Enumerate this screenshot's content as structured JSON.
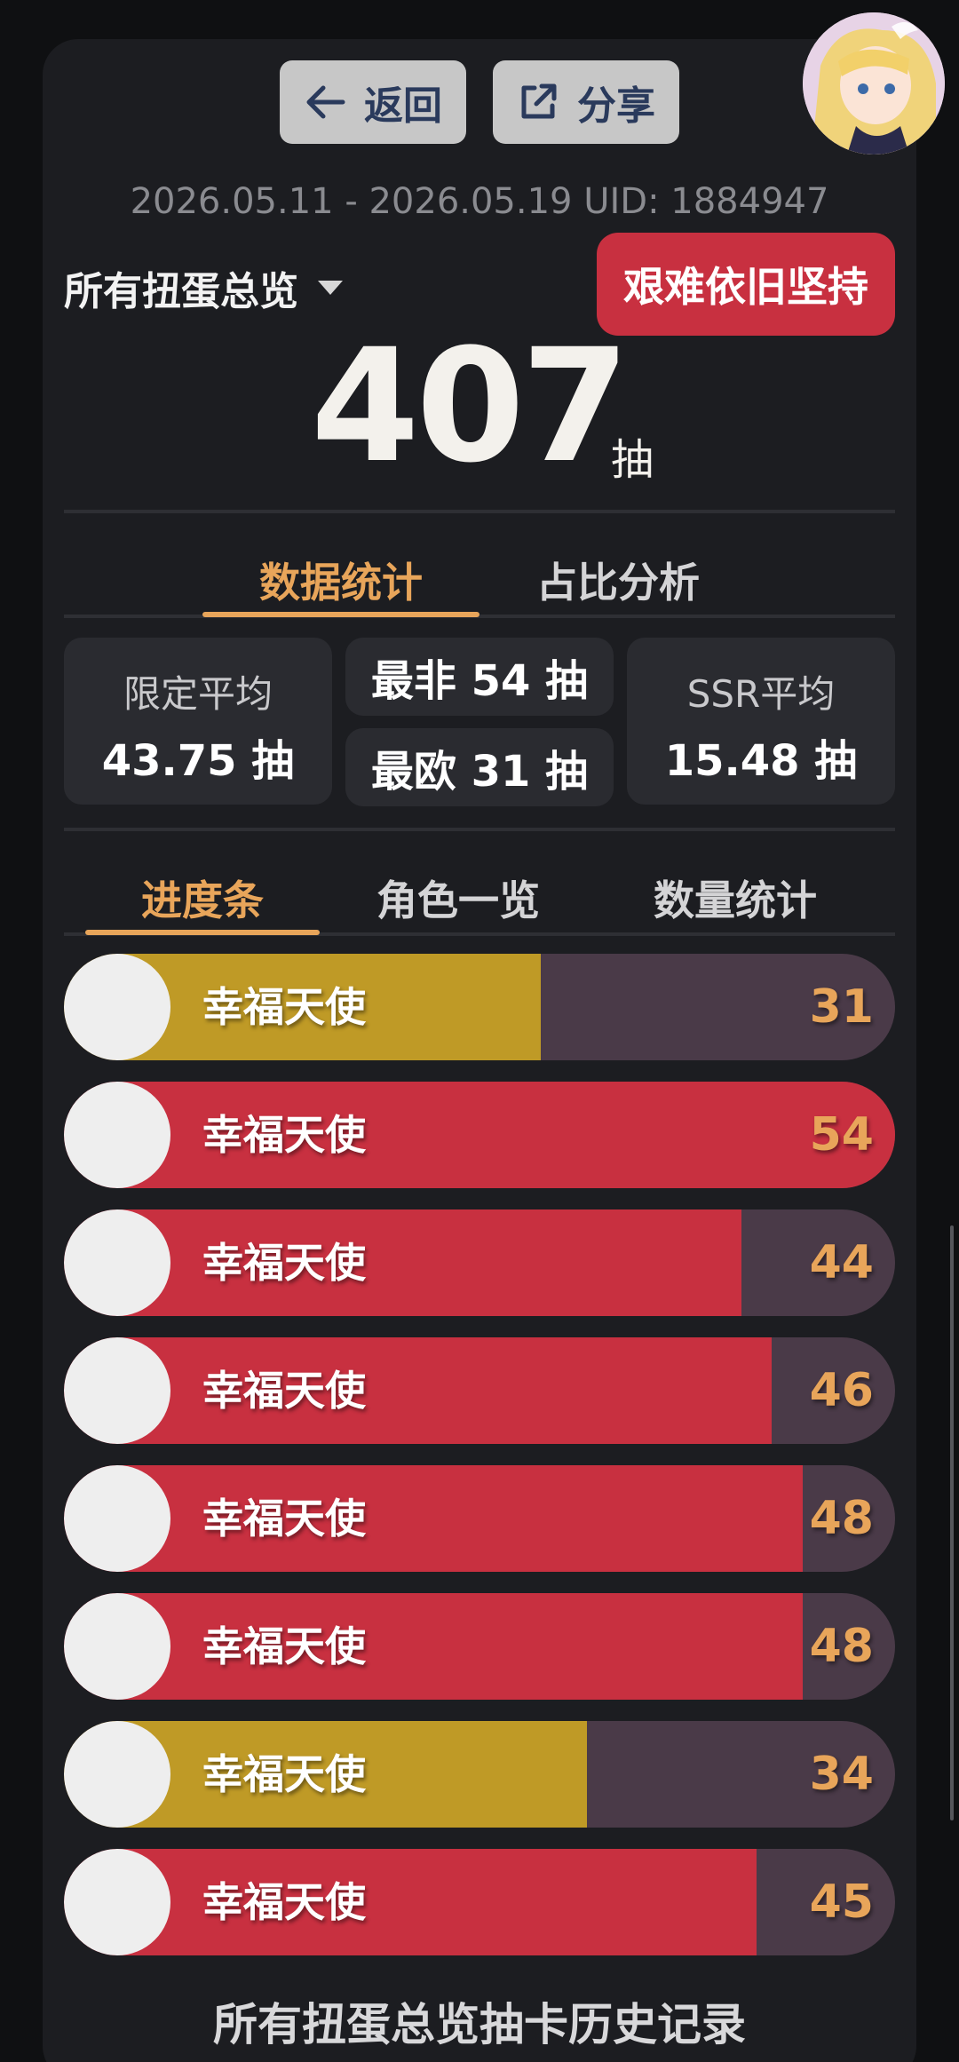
{
  "toolbar": {
    "back_label": "返回",
    "share_label": "分享"
  },
  "header": {
    "date_range_uid": "2026.05.11 - 2026.05.19 UID: 1884947",
    "overview_title": "所有扭蛋总览",
    "status_badge": "艰难依旧坚持",
    "total_pulls": "407",
    "total_unit": "抽"
  },
  "main_tabs": [
    {
      "label": "数据统计",
      "active": true
    },
    {
      "label": "占比分析",
      "active": false
    }
  ],
  "stats": {
    "limited_avg_label": "限定平均",
    "limited_avg_value": "43.75 抽",
    "worst": "最非 54 抽",
    "best": "最欧 31 抽",
    "ssr_avg_label": "SSR平均",
    "ssr_avg_value": "15.48 抽"
  },
  "sub_tabs": [
    {
      "label": "进度条",
      "active": true
    },
    {
      "label": "角色一览",
      "active": false
    },
    {
      "label": "数量统计",
      "active": false
    }
  ],
  "colors": {
    "gold": "#bf9a26",
    "red": "#c83040",
    "track": "#4a3a48",
    "accent": "#e8a55a"
  },
  "progress_scale_max": 54,
  "progress_bars": [
    {
      "name": "幸福天使",
      "count": "31",
      "pulls": 31,
      "color": "gold"
    },
    {
      "name": "幸福天使",
      "count": "54",
      "pulls": 54,
      "color": "red"
    },
    {
      "name": "幸福天使",
      "count": "44",
      "pulls": 44,
      "color": "red"
    },
    {
      "name": "幸福天使",
      "count": "46",
      "pulls": 46,
      "color": "red"
    },
    {
      "name": "幸福天使",
      "count": "48",
      "pulls": 48,
      "color": "red"
    },
    {
      "name": "幸福天使",
      "count": "48",
      "pulls": 48,
      "color": "red"
    },
    {
      "name": "幸福天使",
      "count": "34",
      "pulls": 34,
      "color": "gold"
    },
    {
      "name": "幸福天使",
      "count": "45",
      "pulls": 45,
      "color": "red"
    }
  ],
  "footer": {
    "title": "所有扭蛋总览抽卡历史记录"
  }
}
